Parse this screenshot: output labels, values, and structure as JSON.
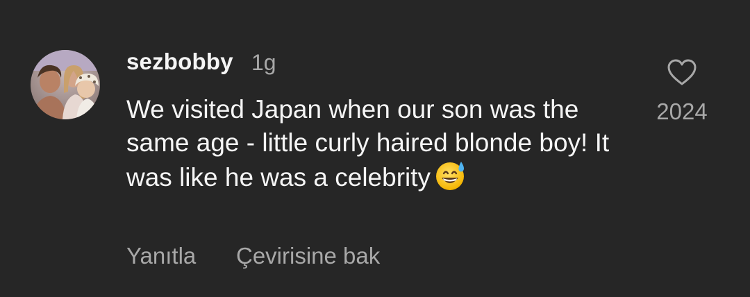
{
  "comment": {
    "username": "sezbobby",
    "timestamp": "1g",
    "text": "We visited Japan when our son was the same age - little curly haired blonde boy! It was like he was a celebrity",
    "emoji": "grinning-face-with-sweat-emoji",
    "like_count": "2024",
    "reply_label": "Yanıtla",
    "translate_label": "Çevirisine bak"
  },
  "colors": {
    "background": "#262626",
    "primary_text": "#f5f5f5",
    "secondary_text": "#a8a8a8"
  },
  "icons": {
    "like": "heart-outline-icon",
    "avatar": "profile-photo"
  }
}
